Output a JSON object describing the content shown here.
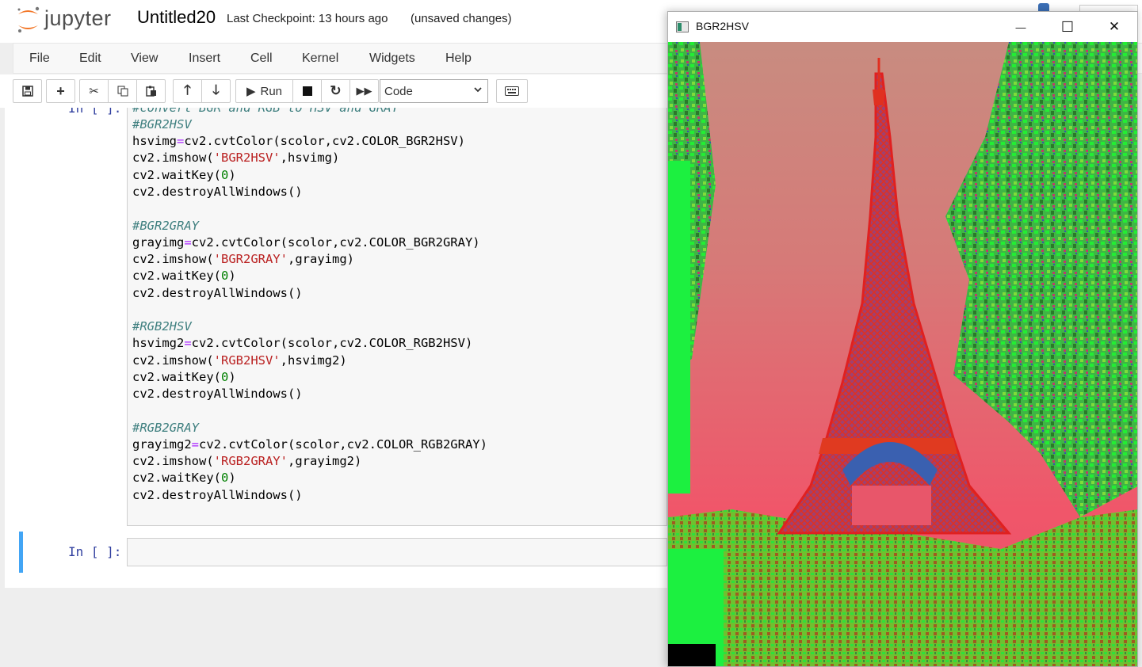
{
  "header": {
    "logo_text": "jupyter",
    "notebook_name": "Untitled20",
    "checkpoint": "Last Checkpoint: 13 hours ago",
    "status": "(unsaved changes)"
  },
  "menu": [
    "File",
    "Edit",
    "View",
    "Insert",
    "Cell",
    "Kernel",
    "Widgets",
    "Help"
  ],
  "toolbar": {
    "run_label": "Run",
    "cell_type": "Code"
  },
  "cell1": {
    "prompt": "In [ ]:",
    "top_partial": "#convert BGR and RGB to HSV and GRAY",
    "comments": [
      "#BGR2HSV",
      "#BGR2GRAY",
      "#RGB2HSV",
      "#RGB2GRAY"
    ],
    "windows": [
      "'BGR2HSV'",
      "'BGR2GRAY'",
      "'RGB2HSV'",
      "'RGB2GRAY'"
    ],
    "vars": [
      "hsvimg",
      "grayimg",
      "hsvimg2",
      "grayimg2"
    ],
    "codes": [
      "cv2.COLOR_BGR2HSV",
      "cv2.COLOR_BGR2GRAY",
      "cv2.COLOR_RGB2HSV",
      "cv2.COLOR_RGB2GRAY"
    ],
    "cvt_prefix": "cv2.cvtColor(scolor,",
    "imshow_prefix": "cv2.imshow(",
    "waitkey_prefix": "cv2.waitKey(",
    "waitkey_arg": "0",
    "destroy": "cv2.destroyAllWindows()"
  },
  "cell2": {
    "prompt": "In [ ]:"
  },
  "image_window": {
    "title": "BGR2HSV",
    "minimize_glyph": "—",
    "maximize_glyph": "☐",
    "close_glyph": "✕"
  },
  "colors": {
    "prompt": "#303f9f",
    "comment": "#408080",
    "string": "#ba2121",
    "selected_border": "#42a5f5",
    "jupyter_orange": "#f37626"
  }
}
